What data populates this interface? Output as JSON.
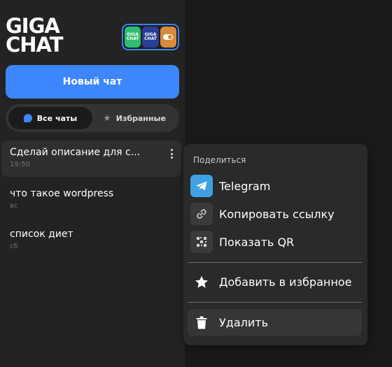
{
  "sidebar": {
    "logo": {
      "line1": "GIGA",
      "line2": "CHAT"
    },
    "mode_switch": {
      "tile1_text": "GIGA CHAT",
      "tile2_text": "GIGA CHAT"
    },
    "new_chat_label": "Новый чат",
    "tabs": [
      {
        "label": "Все чаты",
        "active": true
      },
      {
        "label": "Избранные",
        "active": false
      }
    ],
    "chats": [
      {
        "title": "Сделай описание для с...",
        "time": "19:50",
        "active": true
      },
      {
        "title": "что такое wordpress",
        "time": "вс",
        "active": false
      },
      {
        "title": "список диет",
        "time": "сб",
        "active": false
      }
    ]
  },
  "menu": {
    "header": "Поделиться",
    "items": {
      "telegram": "Telegram",
      "copy_link": "Копировать ссылку",
      "show_qr": "Показать QR",
      "add_favorite": "Добавить в избранное",
      "delete": "Удалить"
    }
  },
  "colors": {
    "accent": "#3d86ff",
    "sidebar_bg": "#232323",
    "menu_bg": "#2a2a2a",
    "telegram": "#3ea2e2"
  }
}
